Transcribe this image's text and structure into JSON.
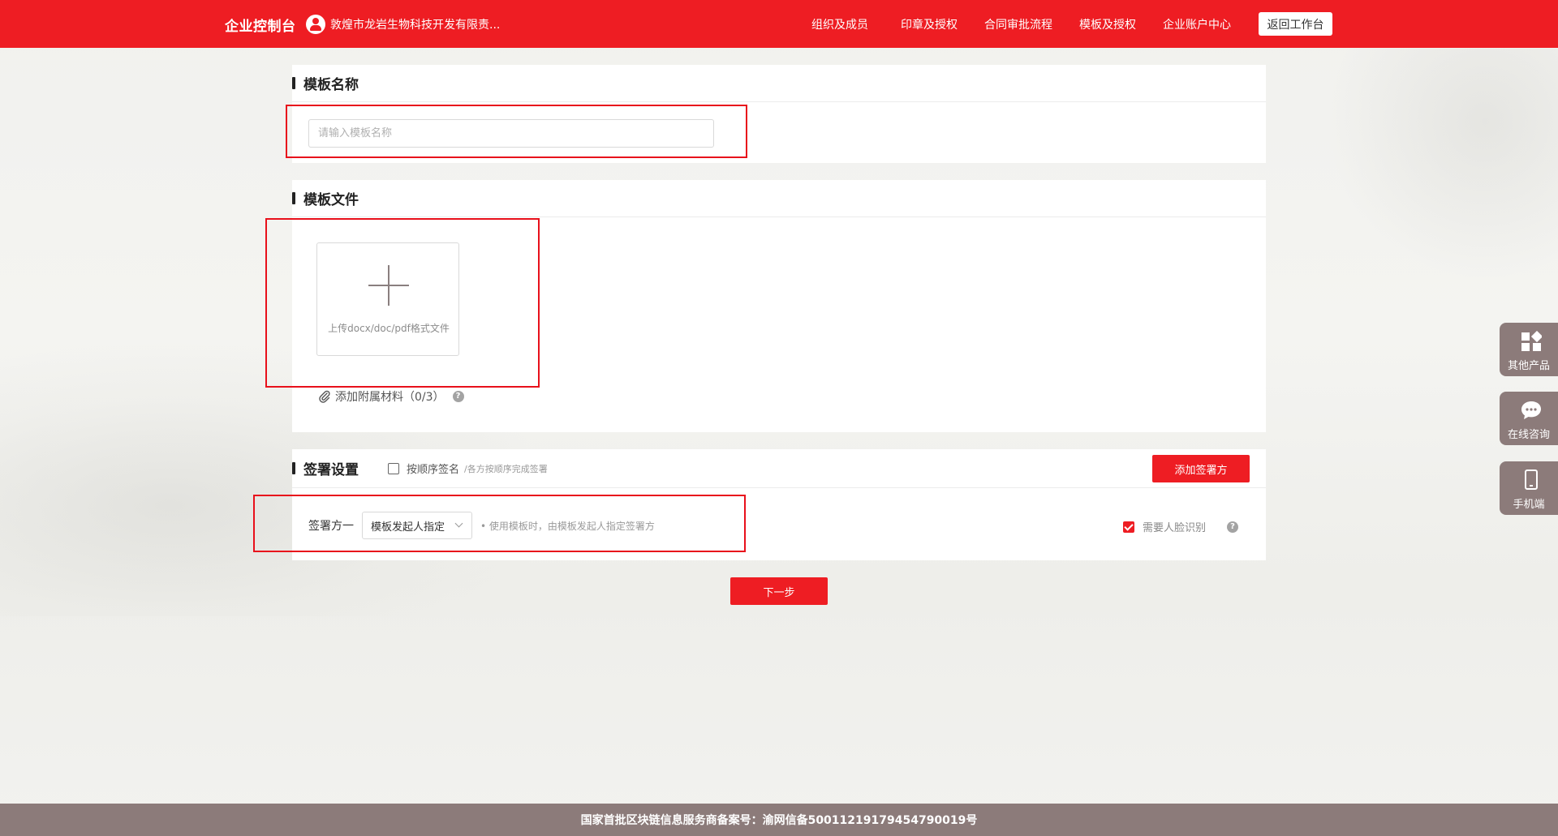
{
  "header": {
    "brand": "企业控制台",
    "company": "敦煌市龙岩生物科技开发有限责...",
    "nav": [
      "组织及成员",
      "印章及授权",
      "合同审批流程",
      "模板及授权",
      "企业账户中心"
    ],
    "back_label": "返回工作台"
  },
  "template_name": {
    "title": "模板名称",
    "placeholder": "请输入模板名称",
    "value": ""
  },
  "template_file": {
    "title": "模板文件",
    "upload_hint": "上传docx/doc/pdf格式文件",
    "attach_label": "添加附属材料（0/3）"
  },
  "sign_settings": {
    "title": "签署设置",
    "sequential_label": "按顺序签名",
    "sequential_hint": "/各方按顺序完成签署",
    "sequential_checked": false,
    "add_signer_label": "添加签署方",
    "signer_label": "签署方一",
    "signer_value": "模板发起人指定",
    "signer_hint": "• 使用模板时，由模板发起人指定签署方",
    "face_label": "需要人脸识别",
    "face_checked": true
  },
  "next_label": "下一步",
  "side_float": [
    "其他产品",
    "在线咨询",
    "手机端"
  ],
  "footer": "国家首批区块链信息服务商备案号：渝网信备50011219179454790019号",
  "colors": {
    "accent": "#ee1d23",
    "footer_bg": "#8c7b7a"
  }
}
